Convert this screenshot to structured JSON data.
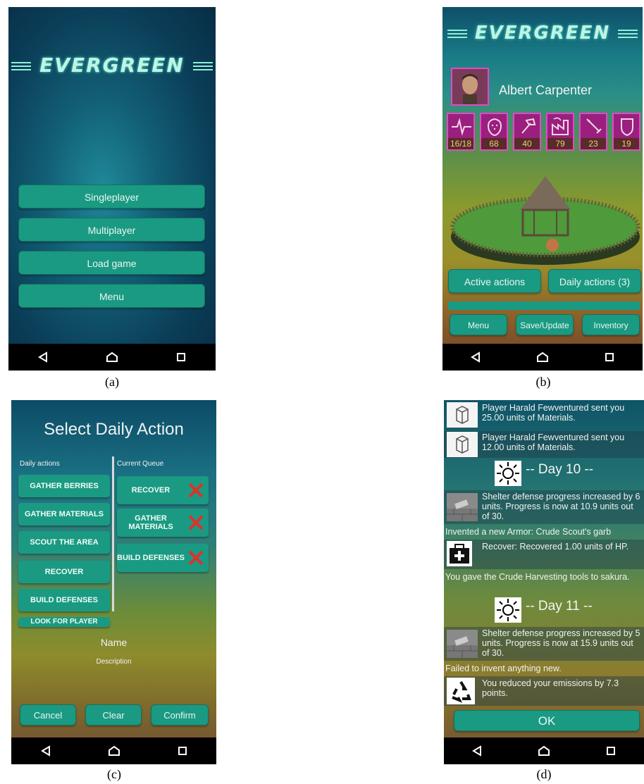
{
  "app_title": "EVERGREEN",
  "screen_a": {
    "buttons": [
      "Singleplayer",
      "Multiplayer",
      "Load game",
      "Menu"
    ]
  },
  "screen_b": {
    "player_name": "Albert Carpenter",
    "stats": [
      {
        "icon": "heartbeat-icon",
        "value": "16/18"
      },
      {
        "icon": "strawberry-icon",
        "value": "68"
      },
      {
        "icon": "hammer-icon",
        "value": "40"
      },
      {
        "icon": "factory-icon",
        "value": "79"
      },
      {
        "icon": "sword-icon",
        "value": "23"
      },
      {
        "icon": "shield-icon",
        "value": "19"
      }
    ],
    "active_actions": "Active actions",
    "daily_actions": "Daily actions (3)",
    "menu": "Menu",
    "save_update": "Save/Update",
    "inventory": "Inventory"
  },
  "screen_c": {
    "title": "Select Daily Action",
    "daily_actions_label": "Daily actions",
    "current_queue_label": "Current Queue",
    "daily_actions": [
      "GATHER BERRIES",
      "GATHER MATERIALS",
      "SCOUT THE AREA",
      "RECOVER",
      "BUILD DEFENSES",
      "LOOK FOR PLAYER"
    ],
    "queue": [
      "RECOVER",
      "GATHER MATERIALS",
      "BUILD DEFENSES"
    ],
    "name_label": "Name",
    "description_label": "Description",
    "cancel": "Cancel",
    "clear": "Clear",
    "confirm": "Confirm"
  },
  "screen_d": {
    "log": [
      "Player Harald Fewventured sent you 25.00 units of Materials.",
      "Player Harald Fewventured sent you 12.00 units of Materials.",
      "-- Day 10 --",
      "Shelter defense progress increased by 6 units. Progress is now at 10.9 units out of 30.",
      "Invented a new Armor: Crude Scout's garb",
      "Recover: Recovered 1.00 units of HP.",
      "You gave the Crude Harvesting tools to sakura.",
      "-- Day 11 --",
      "Shelter defense progress increased by 5 units. Progress is now at 15.9 units out of 30.",
      "Failed to invent anything new.",
      "You reduced your emissions by 7.3 points."
    ],
    "ok": "OK"
  },
  "captions": [
    "(a)",
    "(b)",
    "(c)",
    "(d)"
  ]
}
